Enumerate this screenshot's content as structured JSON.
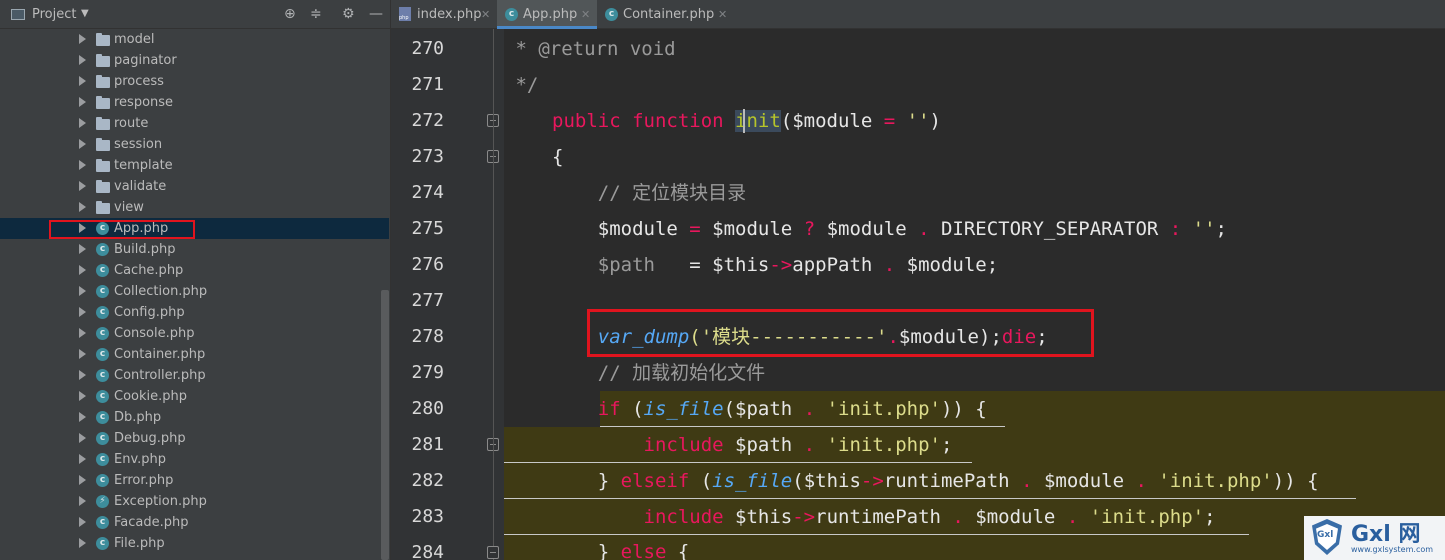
{
  "sidebar": {
    "title": "Project",
    "tools": [
      "locate-icon",
      "collapse-icon",
      "gear-icon",
      "minimize-icon"
    ],
    "folders": [
      "model",
      "paginator",
      "process",
      "response",
      "route",
      "session",
      "template",
      "validate",
      "view"
    ],
    "files": [
      "App.php",
      "Build.php",
      "Cache.php",
      "Collection.php",
      "Config.php",
      "Console.php",
      "Container.php",
      "Controller.php",
      "Cookie.php",
      "Db.php",
      "Debug.php",
      "Env.php",
      "Error.php",
      "Exception.php",
      "Facade.php",
      "File.php"
    ],
    "selected": "App.php"
  },
  "tabs": [
    {
      "label": "index.php",
      "icon": "php-file-icon",
      "active": false
    },
    {
      "label": "App.php",
      "icon": "class-icon",
      "active": true
    },
    {
      "label": "Container.php",
      "icon": "class-icon",
      "active": false
    }
  ],
  "editor": {
    "line_numbers": [
      "270",
      "271",
      "272",
      "273",
      "274",
      "275",
      "276",
      "277",
      "278",
      "279",
      "280",
      "281",
      "282",
      "283",
      "284"
    ],
    "lines": {
      "l270": {
        "a": " * ",
        "b": "@return",
        "c": " void"
      },
      "l271": {
        "a": " */"
      },
      "l272": {
        "a": "public",
        "b": " function ",
        "c": "init",
        "d": "($module",
        "e": " = ",
        "f": "''",
        "g": ")"
      },
      "l273": {
        "a": "{"
      },
      "l274": {
        "a": "    // 定位模块目录"
      },
      "l275": {
        "a": "    $module",
        "b": " = ",
        "c": "$module",
        "d": " ? ",
        "e": "$module",
        "f": " . ",
        "g": "DIRECTORY_SEPARATOR",
        "h": " : ",
        "i": "''",
        "j": ";"
      },
      "l276": {
        "a": "    $path",
        "b": "   = ",
        "c": "$this",
        "d": "->",
        "e": "appPath",
        "f": " . ",
        "g": "$module",
        "h": ";"
      },
      "l278": {
        "a": "    var_dump",
        "b": "('",
        "c": "模块-----------",
        "d": "'",
        "e": ".",
        "f": "$module",
        "g": ");",
        "h": "die",
        "i": ";"
      },
      "l279": {
        "a": "    // 加载初始化文件"
      },
      "l280": {
        "a": "    if",
        "b": " (",
        "c": "is_file",
        "d": "($path",
        "e": " . ",
        "f": "'init.php'",
        "g": ")) {"
      },
      "l281": {
        "a": "        include",
        "b": " $path",
        "c": " . ",
        "d": "'init.php'",
        "e": ";"
      },
      "l282": {
        "a": "    } ",
        "b": "elseif",
        "c": " (",
        "d": "is_file",
        "e": "($this",
        "f": "->",
        "g": "runtimePath",
        "h": " . ",
        "i": "$module",
        "j": " . ",
        "k": "'init.php'",
        "l": ")) {"
      },
      "l283": {
        "a": "        include",
        "b": " $this",
        "c": "->",
        "d": "runtimePath",
        "e": " . ",
        "f": "$module",
        "g": " . ",
        "h": "'init.php'",
        "i": ";"
      },
      "l284": {
        "a": "    } ",
        "b": "else",
        "c": " {"
      }
    }
  },
  "watermark": {
    "brand": "Gxl 网",
    "url": "www.gxlsystem.com",
    "shield": "Gxl"
  }
}
